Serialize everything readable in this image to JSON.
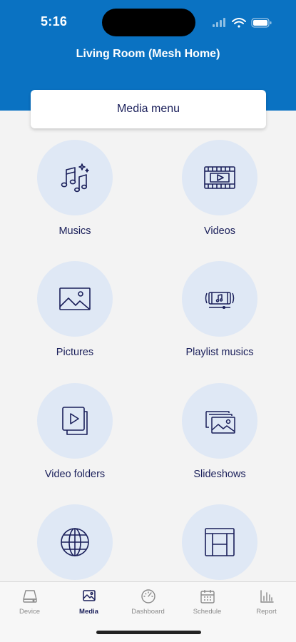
{
  "status_bar": {
    "time": "5:16"
  },
  "header": {
    "title": "Living Room (Mesh Home)"
  },
  "media_menu": {
    "label": "Media menu"
  },
  "tiles": [
    {
      "label": "Musics",
      "icon": "music-notes-icon"
    },
    {
      "label": "Videos",
      "icon": "video-film-icon"
    },
    {
      "label": "Pictures",
      "icon": "picture-icon"
    },
    {
      "label": "Playlist musics",
      "icon": "playlist-icon"
    },
    {
      "label": "Video folders",
      "icon": "video-folder-icon"
    },
    {
      "label": "Slideshows",
      "icon": "slideshow-icon"
    },
    {
      "label": "",
      "icon": "globe-icon"
    },
    {
      "label": "",
      "icon": "layout-icon"
    }
  ],
  "tabbar": {
    "items": [
      {
        "label": "Device",
        "icon": "device-icon",
        "active": false
      },
      {
        "label": "Media",
        "icon": "media-icon",
        "active": true
      },
      {
        "label": "Dashboard",
        "icon": "gauge-icon",
        "active": false
      },
      {
        "label": "Schedule",
        "icon": "calendar-icon",
        "active": false
      },
      {
        "label": "Report",
        "icon": "bar-chart-icon",
        "active": false
      }
    ]
  },
  "colors": {
    "header_bg": "#0a72c2",
    "accent_text": "#1a1f5a",
    "tile_bg": "#dfe8f5"
  }
}
